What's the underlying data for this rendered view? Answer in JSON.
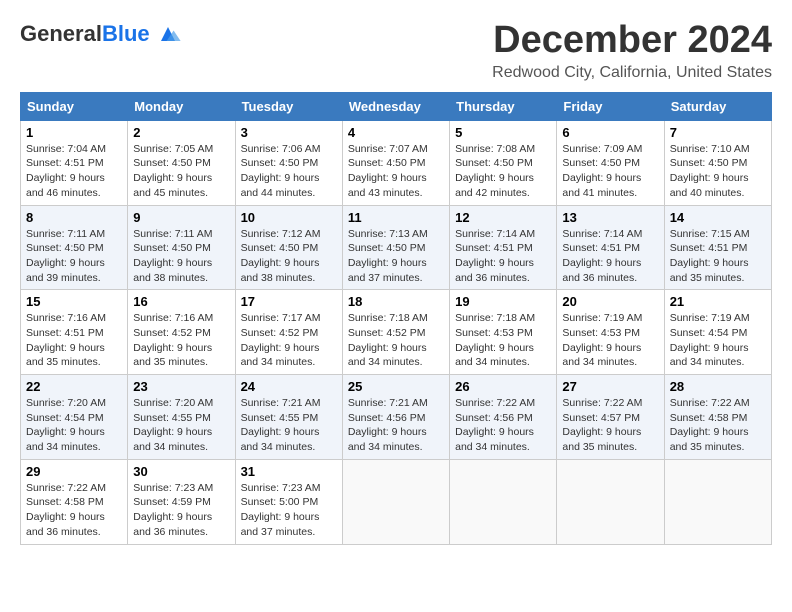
{
  "header": {
    "logo_general": "General",
    "logo_blue": "Blue",
    "month_title": "December 2024",
    "location": "Redwood City, California, United States"
  },
  "calendar": {
    "days_of_week": [
      "Sunday",
      "Monday",
      "Tuesday",
      "Wednesday",
      "Thursday",
      "Friday",
      "Saturday"
    ],
    "weeks": [
      [
        {
          "day": "1",
          "sunrise": "7:04 AM",
          "sunset": "4:51 PM",
          "daylight": "9 hours and 46 minutes."
        },
        {
          "day": "2",
          "sunrise": "7:05 AM",
          "sunset": "4:50 PM",
          "daylight": "9 hours and 45 minutes."
        },
        {
          "day": "3",
          "sunrise": "7:06 AM",
          "sunset": "4:50 PM",
          "daylight": "9 hours and 44 minutes."
        },
        {
          "day": "4",
          "sunrise": "7:07 AM",
          "sunset": "4:50 PM",
          "daylight": "9 hours and 43 minutes."
        },
        {
          "day": "5",
          "sunrise": "7:08 AM",
          "sunset": "4:50 PM",
          "daylight": "9 hours and 42 minutes."
        },
        {
          "day": "6",
          "sunrise": "7:09 AM",
          "sunset": "4:50 PM",
          "daylight": "9 hours and 41 minutes."
        },
        {
          "day": "7",
          "sunrise": "7:10 AM",
          "sunset": "4:50 PM",
          "daylight": "9 hours and 40 minutes."
        }
      ],
      [
        {
          "day": "8",
          "sunrise": "7:11 AM",
          "sunset": "4:50 PM",
          "daylight": "9 hours and 39 minutes."
        },
        {
          "day": "9",
          "sunrise": "7:11 AM",
          "sunset": "4:50 PM",
          "daylight": "9 hours and 38 minutes."
        },
        {
          "day": "10",
          "sunrise": "7:12 AM",
          "sunset": "4:50 PM",
          "daylight": "9 hours and 38 minutes."
        },
        {
          "day": "11",
          "sunrise": "7:13 AM",
          "sunset": "4:50 PM",
          "daylight": "9 hours and 37 minutes."
        },
        {
          "day": "12",
          "sunrise": "7:14 AM",
          "sunset": "4:51 PM",
          "daylight": "9 hours and 36 minutes."
        },
        {
          "day": "13",
          "sunrise": "7:14 AM",
          "sunset": "4:51 PM",
          "daylight": "9 hours and 36 minutes."
        },
        {
          "day": "14",
          "sunrise": "7:15 AM",
          "sunset": "4:51 PM",
          "daylight": "9 hours and 35 minutes."
        }
      ],
      [
        {
          "day": "15",
          "sunrise": "7:16 AM",
          "sunset": "4:51 PM",
          "daylight": "9 hours and 35 minutes."
        },
        {
          "day": "16",
          "sunrise": "7:16 AM",
          "sunset": "4:52 PM",
          "daylight": "9 hours and 35 minutes."
        },
        {
          "day": "17",
          "sunrise": "7:17 AM",
          "sunset": "4:52 PM",
          "daylight": "9 hours and 34 minutes."
        },
        {
          "day": "18",
          "sunrise": "7:18 AM",
          "sunset": "4:52 PM",
          "daylight": "9 hours and 34 minutes."
        },
        {
          "day": "19",
          "sunrise": "7:18 AM",
          "sunset": "4:53 PM",
          "daylight": "9 hours and 34 minutes."
        },
        {
          "day": "20",
          "sunrise": "7:19 AM",
          "sunset": "4:53 PM",
          "daylight": "9 hours and 34 minutes."
        },
        {
          "day": "21",
          "sunrise": "7:19 AM",
          "sunset": "4:54 PM",
          "daylight": "9 hours and 34 minutes."
        }
      ],
      [
        {
          "day": "22",
          "sunrise": "7:20 AM",
          "sunset": "4:54 PM",
          "daylight": "9 hours and 34 minutes."
        },
        {
          "day": "23",
          "sunrise": "7:20 AM",
          "sunset": "4:55 PM",
          "daylight": "9 hours and 34 minutes."
        },
        {
          "day": "24",
          "sunrise": "7:21 AM",
          "sunset": "4:55 PM",
          "daylight": "9 hours and 34 minutes."
        },
        {
          "day": "25",
          "sunrise": "7:21 AM",
          "sunset": "4:56 PM",
          "daylight": "9 hours and 34 minutes."
        },
        {
          "day": "26",
          "sunrise": "7:22 AM",
          "sunset": "4:56 PM",
          "daylight": "9 hours and 34 minutes."
        },
        {
          "day": "27",
          "sunrise": "7:22 AM",
          "sunset": "4:57 PM",
          "daylight": "9 hours and 35 minutes."
        },
        {
          "day": "28",
          "sunrise": "7:22 AM",
          "sunset": "4:58 PM",
          "daylight": "9 hours and 35 minutes."
        }
      ],
      [
        {
          "day": "29",
          "sunrise": "7:22 AM",
          "sunset": "4:58 PM",
          "daylight": "9 hours and 36 minutes."
        },
        {
          "day": "30",
          "sunrise": "7:23 AM",
          "sunset": "4:59 PM",
          "daylight": "9 hours and 36 minutes."
        },
        {
          "day": "31",
          "sunrise": "7:23 AM",
          "sunset": "5:00 PM",
          "daylight": "9 hours and 37 minutes."
        },
        null,
        null,
        null,
        null
      ]
    ]
  }
}
